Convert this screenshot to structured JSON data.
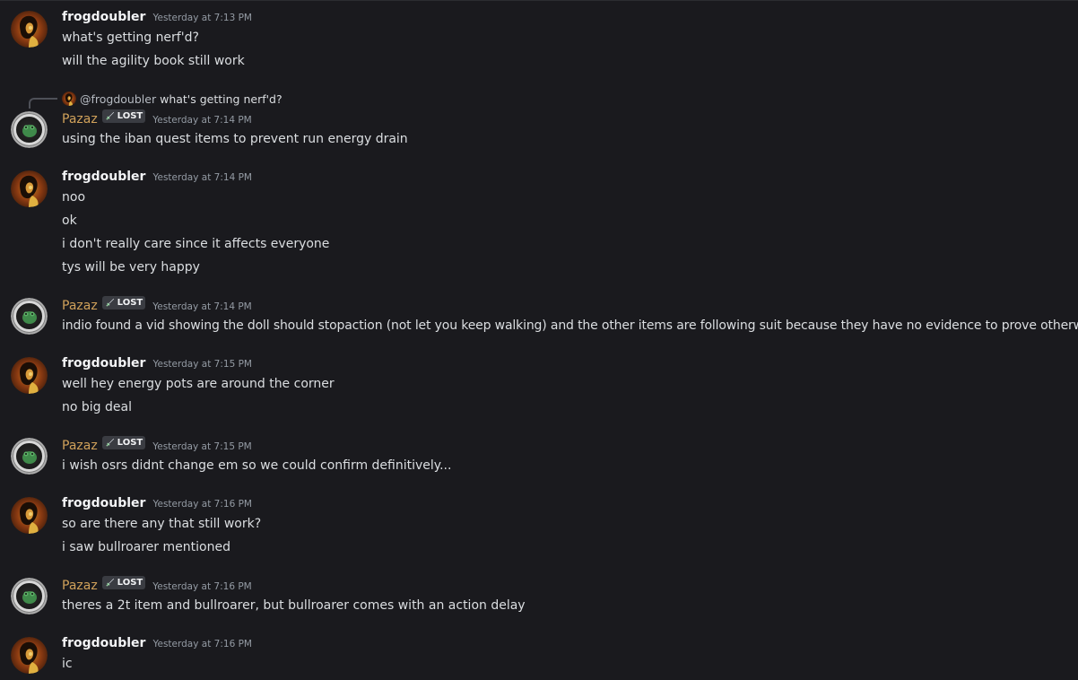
{
  "users": {
    "frog": {
      "name": "frogdoubler",
      "mention": "@frogdoubler"
    },
    "pazaz": {
      "name": "Pazaz",
      "tag": "LOST",
      "color": "#d0a15a"
    }
  },
  "reply": {
    "name": "@frogdoubler",
    "text": "what's getting nerf'd?"
  },
  "messages": [
    {
      "author": "frogdoubler",
      "time": "Yesterday at 7:13 PM",
      "lines": [
        "what's getting nerf'd?",
        "will the agility book still work"
      ]
    },
    {
      "author": "Pazaz",
      "time": "Yesterday at 7:14 PM",
      "lines": [
        "using the iban quest items to prevent run energy drain"
      ]
    },
    {
      "author": "frogdoubler",
      "time": "Yesterday at 7:14 PM",
      "lines": [
        "noo",
        "ok",
        "i don't really care since it affects everyone",
        "tys will be very happy"
      ]
    },
    {
      "author": "Pazaz",
      "time": "Yesterday at 7:14 PM",
      "lines": [
        "indio found a vid showing the doll should stopaction (not let you keep walking) and the other items are following suit because they have no evidence to prove otherwise"
      ]
    },
    {
      "author": "frogdoubler",
      "time": "Yesterday at 7:15 PM",
      "lines": [
        "well hey energy pots are around the corner",
        "no big deal"
      ]
    },
    {
      "author": "Pazaz",
      "time": "Yesterday at 7:15 PM",
      "lines": [
        "i wish osrs didnt change em so we could confirm definitively..."
      ]
    },
    {
      "author": "frogdoubler",
      "time": "Yesterday at 7:16 PM",
      "lines": [
        "so are there any that still work?",
        "i saw bullroarer mentioned"
      ]
    },
    {
      "author": "Pazaz",
      "time": "Yesterday at 7:16 PM",
      "lines": [
        "theres a 2t item and bullroarer, but bullroarer comes with an action delay"
      ]
    },
    {
      "author": "frogdoubler",
      "time": "Yesterday at 7:16 PM",
      "lines": [
        "ic"
      ]
    }
  ]
}
